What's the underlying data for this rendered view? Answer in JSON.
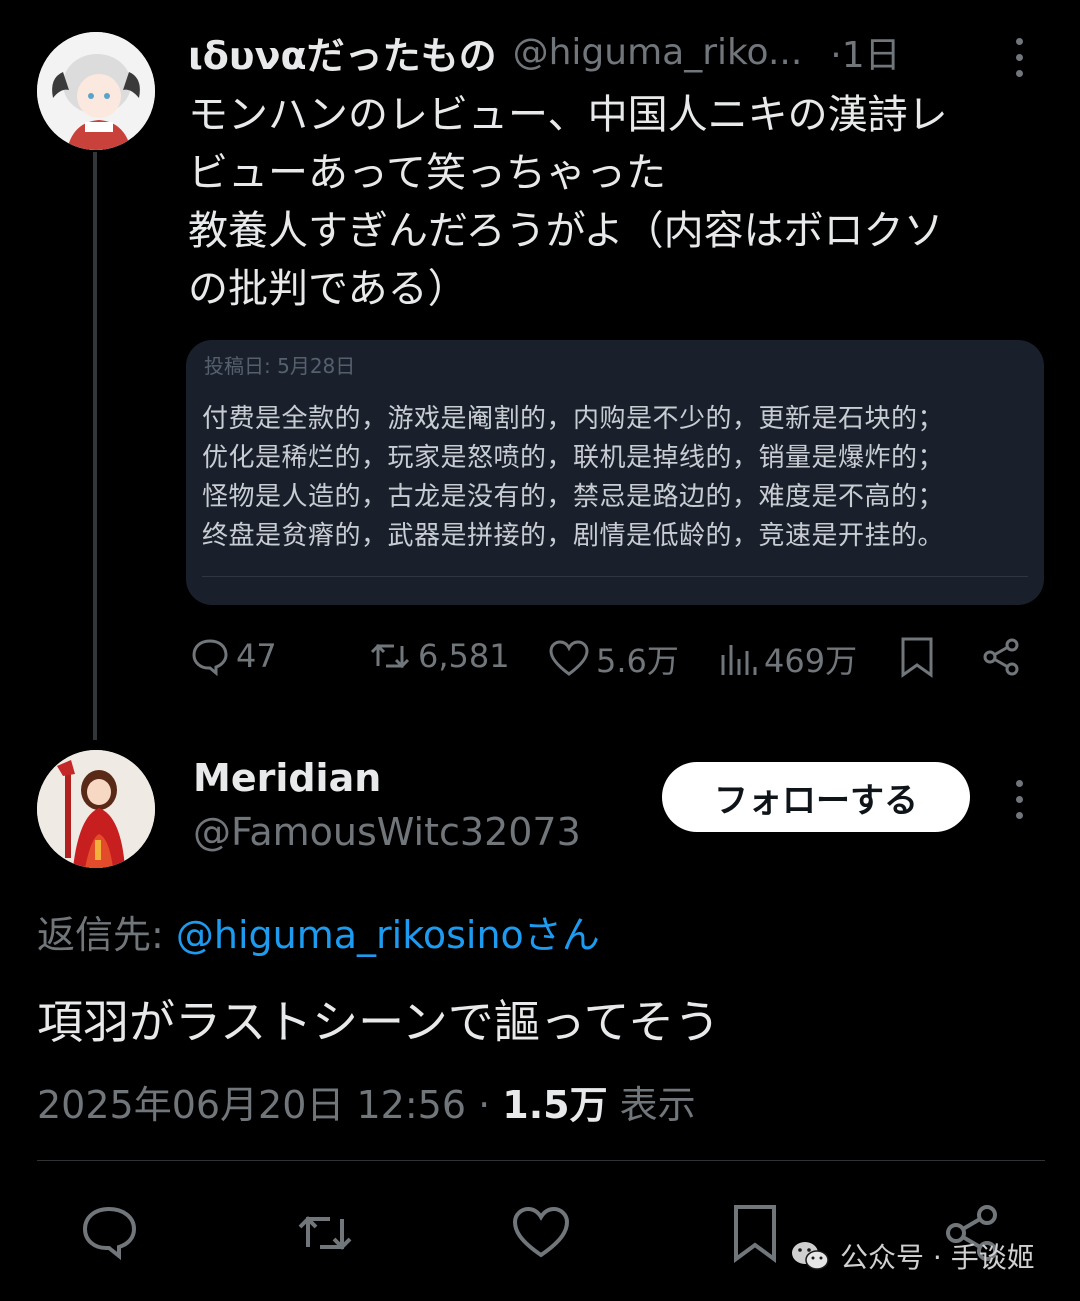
{
  "original_tweet": {
    "display_name": "ιδυναだったもの",
    "handle": "@higuma_riko...",
    "time": "·1日",
    "text": "モンハンのレビュー、中国人ニキの漢詩レ\nビューあって笑っちゃった\n教養人すぎんだろうがよ（内容はボロクソ\nの批判である）",
    "embed": {
      "date": "投稿日: 5月28日",
      "lines": [
        "付费是全款的，游戏是阉割的，内购是不少的，更新是石块的；",
        "优化是稀烂的，玩家是怒喷的，联机是掉线的，销量是爆炸的；",
        "怪物是人造的，古龙是没有的，禁忌是路边的，难度是不高的；",
        "终盘是贫瘠的，武器是拼接的，剧情是低龄的，竞速是开挂的。"
      ]
    },
    "actions": {
      "replies": "47",
      "retweets": "6,581",
      "likes": "5.6万",
      "views": "469万"
    }
  },
  "reply_tweet": {
    "display_name": "Meridian",
    "handle": "@FamousWitc32073",
    "follow_label": "フォローする",
    "reply_to_prefix": "返信先: ",
    "reply_to_handle": "@higuma_rikosinoさん",
    "text": "項羽がラストシーンで謳ってそう",
    "timestamp": "2025年06月20日 12:56",
    "separator": " · ",
    "view_count": "1.5万",
    "view_label": " 表示"
  },
  "watermark": {
    "text": "公众号 · 手谈姬"
  },
  "colors": {
    "background": "#000000",
    "text": "#e7e9ea",
    "muted": "#71767b",
    "link": "#1d9bf0",
    "embed_bg": "#1a202b"
  }
}
